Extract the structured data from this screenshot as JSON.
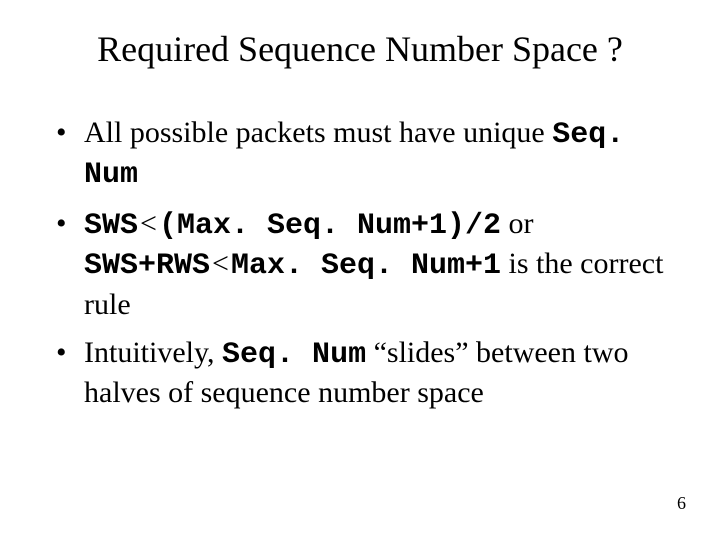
{
  "title": "Required Sequence Number Space ?",
  "bullets": {
    "b1_pre": "All possible packets must have unique ",
    "b1_code": "Seq. Num",
    "b2_code1": "SWS",
    "b2_lt1": "<",
    "b2_code2": "(Max. Seq. Num+1)/2",
    "b2_or": " or ",
    "b2_code3": "SWS+RWS",
    "b2_lt2": "<",
    "b2_code4": "Max. Seq. Num+1",
    "b2_tail": " is the correct rule",
    "b3_pre": "Intuitively, ",
    "b3_code": "Seq. Num",
    "b3_tail": " “slides” between two halves of sequence number space"
  },
  "page_number": "6"
}
